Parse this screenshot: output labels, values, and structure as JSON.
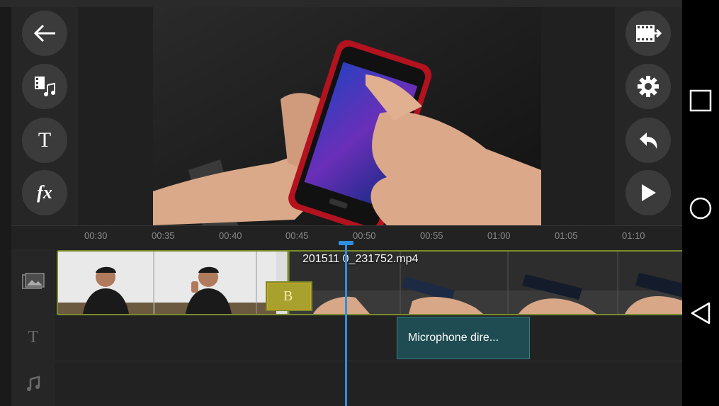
{
  "left_toolbar": [
    {
      "name": "back-button",
      "icon": "arrow-left-icon"
    },
    {
      "name": "media-browser-button",
      "icon": "film-music-icon"
    },
    {
      "name": "add-text-button",
      "icon": "text-T-icon",
      "glyph": "T"
    },
    {
      "name": "effects-button",
      "icon": "fx-icon",
      "glyph": "fx"
    }
  ],
  "right_toolbar": [
    {
      "name": "export-button",
      "icon": "film-export-icon"
    },
    {
      "name": "settings-button",
      "icon": "gear-icon"
    },
    {
      "name": "undo-button",
      "icon": "undo-icon"
    },
    {
      "name": "play-button",
      "icon": "play-icon"
    }
  ],
  "ruler": {
    "labels": [
      "00:30",
      "00:35",
      "00:40",
      "00:45",
      "00:50",
      "00:55",
      "01:00",
      "01:05",
      "01:10"
    ]
  },
  "tracks": {
    "video": {
      "icon": "image-track-icon",
      "clip_filename": "201511 0_231752.mp4",
      "transition_glyph": "B"
    },
    "text": {
      "icon": "text-track-icon",
      "glyph": "T",
      "clip_label": "Microphone dire..."
    },
    "audio": {
      "icon": "music-track-icon"
    }
  },
  "android_nav": {
    "recents": "square-icon",
    "home": "circle-icon",
    "back": "triangle-back-icon"
  },
  "colors": {
    "accent": "#2e8ee0",
    "clip_border": "#7a8b2c",
    "text_clip": "#1e4c52"
  }
}
